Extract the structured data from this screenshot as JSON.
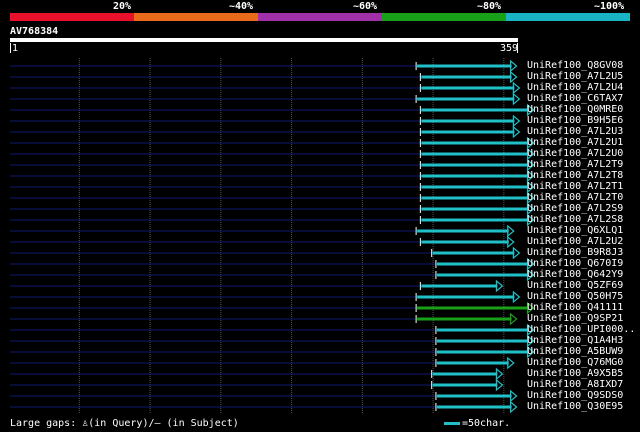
{
  "legend": {
    "labels": [
      "20%",
      "~40%",
      "~60%",
      "~80%",
      "~100%"
    ],
    "colors": [
      "#e8102a",
      "#e86a1a",
      "#a030a8",
      "#18a018",
      "#18b4c4"
    ]
  },
  "query": {
    "name": "AV768384",
    "start": "1",
    "end": "359",
    "length": 359
  },
  "colors": {
    "hit": "#20c0c8",
    "hit_green": "#19a019",
    "gap": "#101870",
    "grid": "#555555"
  },
  "hits": [
    {
      "label": "UniRef100_Q8GV08",
      "start": 288,
      "end": 359,
      "color": "hit"
    },
    {
      "label": "UniRef100_A7L2U5",
      "start": 291,
      "end": 359,
      "color": "hit"
    },
    {
      "label": "UniRef100_A7L2U4",
      "start": 291,
      "end": 361,
      "color": "hit"
    },
    {
      "label": "UniRef100_C6TAX7",
      "start": 288,
      "end": 361,
      "color": "hit"
    },
    {
      "label": "UniRef100_Q0MRE0",
      "start": 291,
      "end": 371,
      "color": "hit"
    },
    {
      "label": "UniRef100_B9H5E6",
      "start": 291,
      "end": 361,
      "color": "hit"
    },
    {
      "label": "UniRef100_A7L2U3",
      "start": 291,
      "end": 361,
      "color": "hit"
    },
    {
      "label": "UniRef100_A7L2U1",
      "start": 291,
      "end": 371,
      "color": "hit"
    },
    {
      "label": "UniRef100_A7L2U0",
      "start": 291,
      "end": 371,
      "color": "hit"
    },
    {
      "label": "UniRef100_A7L2T9",
      "start": 291,
      "end": 371,
      "color": "hit"
    },
    {
      "label": "UniRef100_A7L2T8",
      "start": 291,
      "end": 371,
      "color": "hit"
    },
    {
      "label": "UniRef100_A7L2T1",
      "start": 291,
      "end": 371,
      "color": "hit"
    },
    {
      "label": "UniRef100_A7L2T0",
      "start": 291,
      "end": 371,
      "color": "hit"
    },
    {
      "label": "UniRef100_A7L2S9",
      "start": 291,
      "end": 371,
      "color": "hit"
    },
    {
      "label": "UniRef100_A7L2S8",
      "start": 291,
      "end": 371,
      "color": "hit"
    },
    {
      "label": "UniRef100_Q6XLQ1",
      "start": 288,
      "end": 357,
      "color": "hit"
    },
    {
      "label": "UniRef100_A7L2U2",
      "start": 291,
      "end": 357,
      "color": "hit"
    },
    {
      "label": "UniRef100_B9R8J3",
      "start": 299,
      "end": 361,
      "color": "hit"
    },
    {
      "label": "UniRef100_Q670I9",
      "start": 302,
      "end": 371,
      "color": "hit"
    },
    {
      "label": "UniRef100_Q642Y9",
      "start": 302,
      "end": 371,
      "color": "hit"
    },
    {
      "label": "UniRef100_Q5ZF69",
      "start": 291,
      "end": 349,
      "color": "hit"
    },
    {
      "label": "UniRef100_Q50H75",
      "start": 288,
      "end": 361,
      "color": "hit"
    },
    {
      "label": "UniRef100_Q41111",
      "start": 288,
      "end": 371,
      "color": "hit_green"
    },
    {
      "label": "UniRef100_Q9SP21",
      "start": 288,
      "end": 359,
      "color": "hit_green"
    },
    {
      "label": "UniRef100_UPI000..",
      "start": 302,
      "end": 371,
      "color": "hit"
    },
    {
      "label": "UniRef100_Q1A4H3",
      "start": 302,
      "end": 371,
      "color": "hit"
    },
    {
      "label": "UniRef100_A5BUW9",
      "start": 302,
      "end": 371,
      "color": "hit"
    },
    {
      "label": "UniRef100_Q76MG0",
      "start": 302,
      "end": 357,
      "color": "hit"
    },
    {
      "label": "UniRef100_A9X5B5",
      "start": 299,
      "end": 349,
      "color": "hit"
    },
    {
      "label": "UniRef100_A8IXD7",
      "start": 299,
      "end": 349,
      "color": "hit"
    },
    {
      "label": "UniRef100_Q9SDS0",
      "start": 302,
      "end": 359,
      "color": "hit"
    },
    {
      "label": "UniRef100_Q30E95",
      "start": 302,
      "end": 359,
      "color": "hit"
    }
  ],
  "footer": {
    "gaps_text": "Large gaps: ♙(in Query)/– (in Subject)",
    "scale_text": "=50char."
  }
}
